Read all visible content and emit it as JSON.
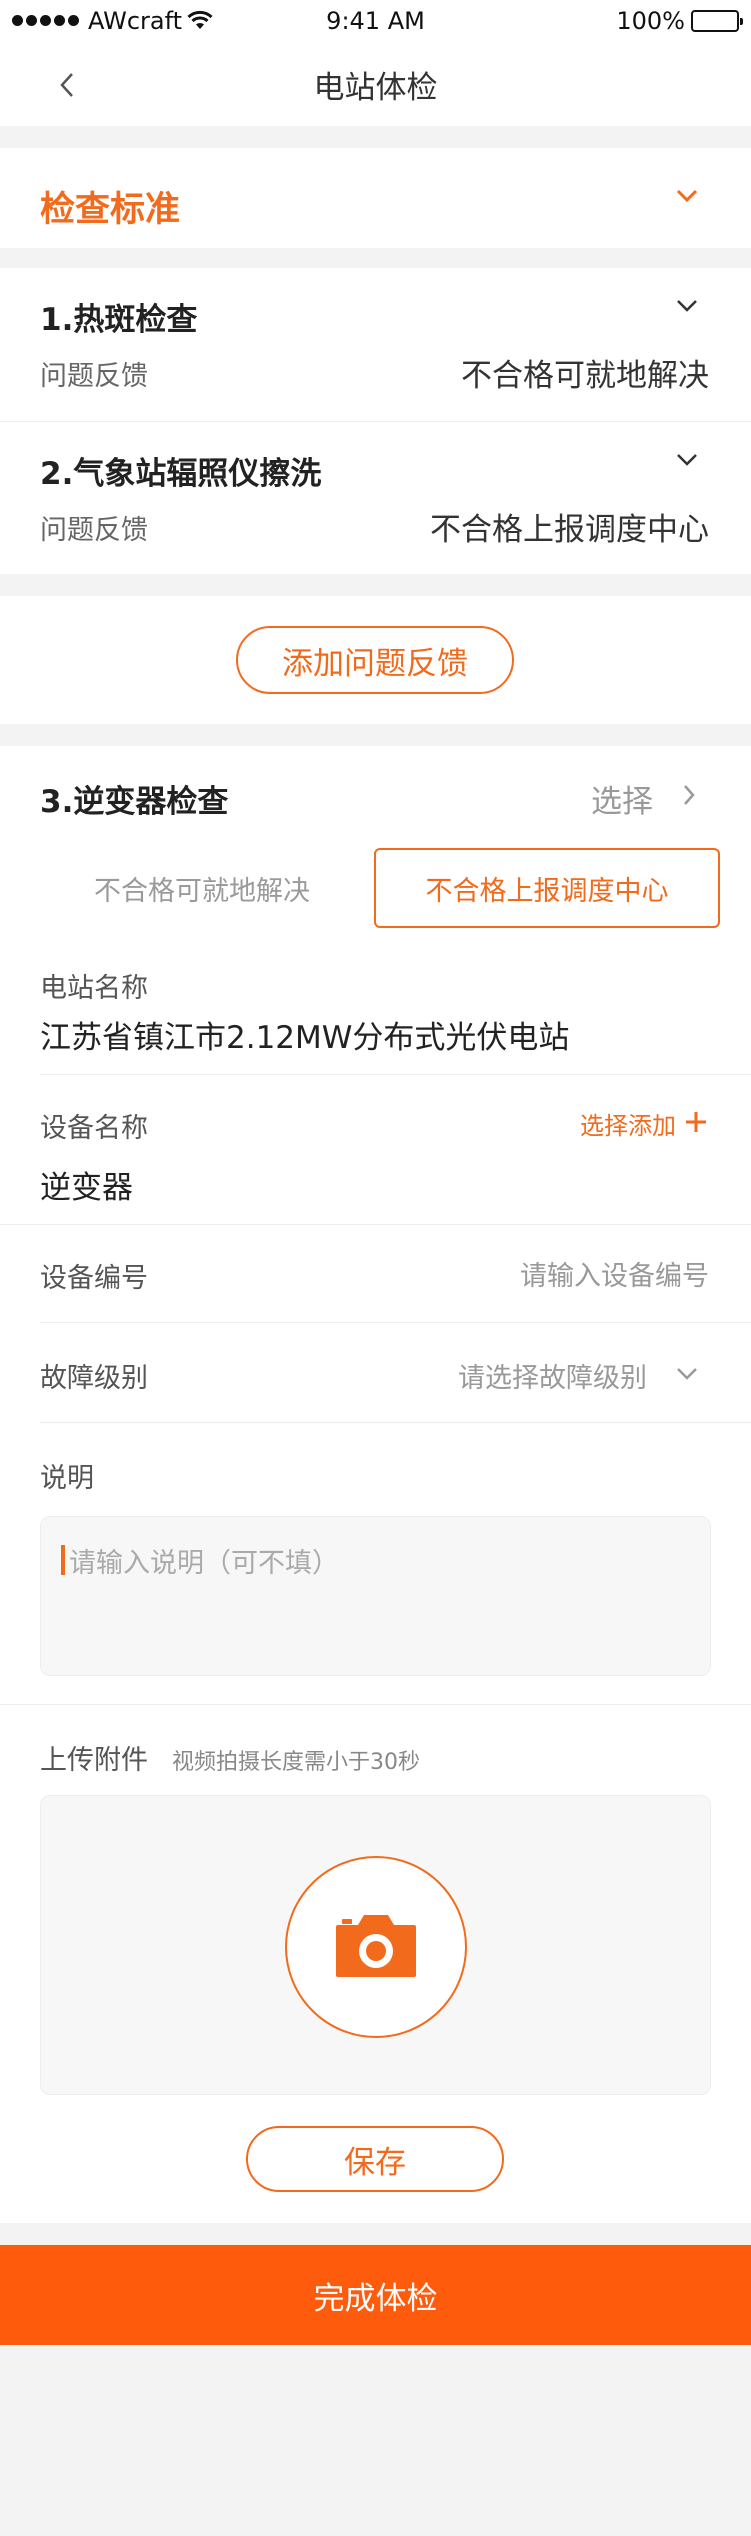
{
  "status": {
    "carrier": "AWcraft",
    "time": "9:41 AM",
    "battery": "100%"
  },
  "nav": {
    "title": "电站体检"
  },
  "standards": {
    "title": "检查标准"
  },
  "items": [
    {
      "title": "1.热斑检查",
      "feedback_label": "问题反馈",
      "feedback_value": "不合格可就地解决"
    },
    {
      "title": "2.气象站辐照仪擦洗",
      "feedback_label": "问题反馈",
      "feedback_value": "不合格上报调度中心"
    }
  ],
  "add_feedback_label": "添加问题反馈",
  "inverter": {
    "title": "3.逆变器检查",
    "select_label": "选择",
    "options": [
      "不合格可就地解决",
      "不合格上报调度中心"
    ],
    "selected_index": 1
  },
  "form": {
    "station_label": "电站名称",
    "station_value": "江苏省镇江市2.12MW分布式光伏电站",
    "device_label": "设备名称",
    "device_add_label": "选择添加",
    "device_value": "逆变器",
    "device_no_label": "设备编号",
    "device_no_placeholder": "请输入设备编号",
    "fault_label": "故障级别",
    "fault_placeholder": "请选择故障级别",
    "desc_label": "说明",
    "desc_placeholder": "请输入说明（可不填）",
    "upload_label": "上传附件",
    "upload_hint": "视频拍摄长度需小于30秒"
  },
  "save_label": "保存",
  "finish_label": "完成体检",
  "colors": {
    "accent": "#f26a1b",
    "primary_button": "#ff5b0c"
  }
}
